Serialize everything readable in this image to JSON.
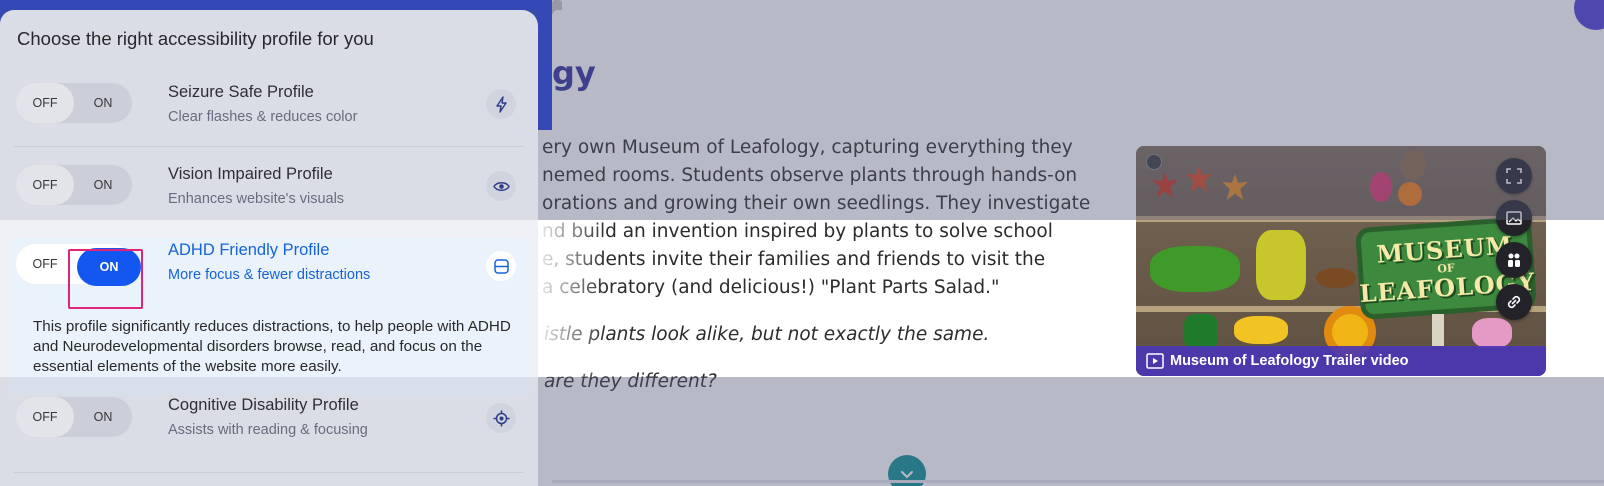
{
  "page": {
    "title": "gy",
    "body_lines": [
      "ery own Museum of Leafology, capturing everything they",
      "nemed rooms. Students observe plants through hands-on",
      "orations and growing their own seedlings. They investigate",
      "nd build an invention inspired by plants to solve school",
      "e, students invite their families and friends to visit the",
      "a celebratory (and delicious!) \"Plant Parts Salad.\""
    ],
    "italic_line_1": "istle plants look alike, but not exactly the same.",
    "italic_line_2": "are they different?"
  },
  "video": {
    "caption": "Museum of Leafology Trailer video",
    "sign_top": "MUSEUM",
    "sign_mid": "OF",
    "sign_bottom": "LEAFOLOGY"
  },
  "panel": {
    "heading": "Choose the right accessibility profile for you",
    "toggle_off_label": "OFF",
    "toggle_on_label": "ON",
    "profiles": [
      {
        "title": "Seizure Safe Profile",
        "subtitle": "Clear flashes & reduces color",
        "icon": "lightning-icon",
        "state": "OFF"
      },
      {
        "title": "Vision Impaired Profile",
        "subtitle": "Enhances website's visuals",
        "icon": "eye-icon",
        "state": "OFF"
      },
      {
        "title": "ADHD Friendly Profile",
        "subtitle": "More focus & fewer distractions",
        "icon": "reading-mask-icon",
        "state": "ON",
        "description": "This profile significantly reduces distractions, to help people with ADHD and Neurodevelopmental disorders browse, read, and focus on the essential elements of the website more easily."
      },
      {
        "title": "Cognitive Disability Profile",
        "subtitle": "Assists with reading & focusing",
        "icon": "target-icon",
        "state": "OFF"
      }
    ]
  },
  "colors": {
    "accent_blue": "#1456f0",
    "active_text": "#1663d8",
    "highlight_box": "#e0247a",
    "title_purple": "#2e2f9e",
    "caption_bar": "#4c36b4"
  }
}
